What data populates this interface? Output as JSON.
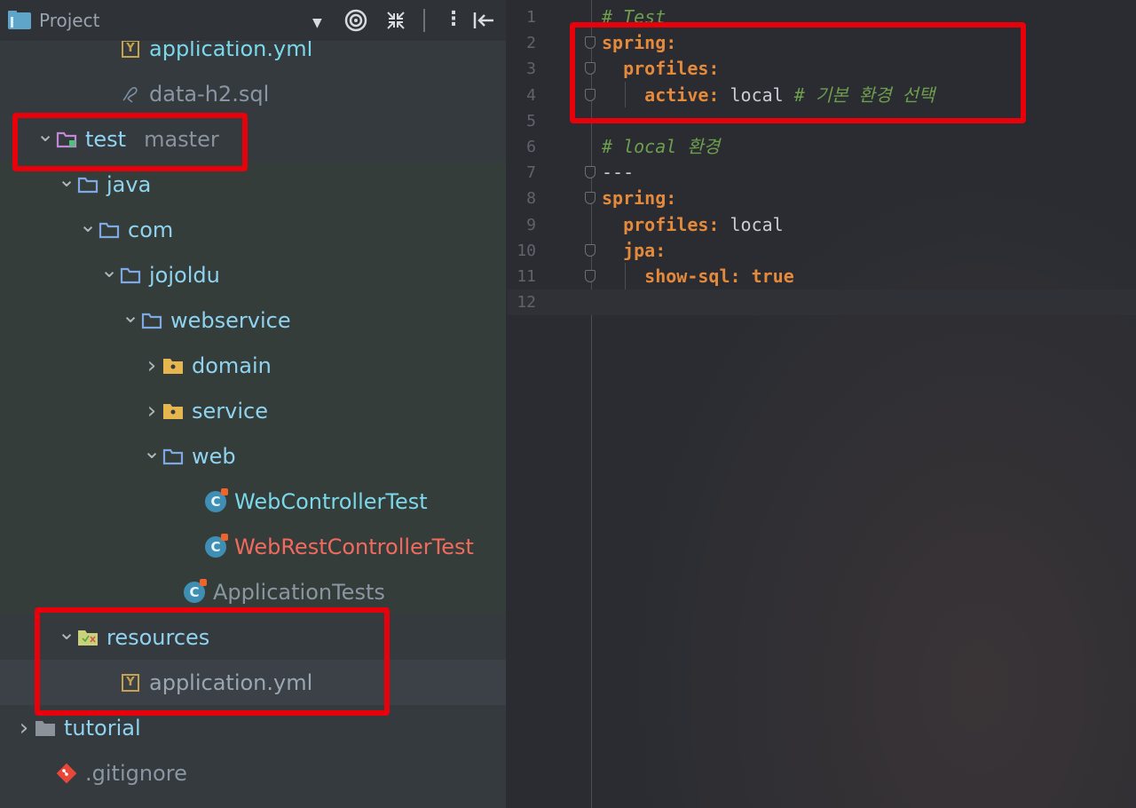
{
  "project_panel": {
    "title": "Project",
    "toolbar_icons": [
      "target-icon",
      "collapse-icon",
      "more-icon",
      "hide-panel-icon"
    ],
    "tree": [
      {
        "label": "application.yml",
        "icon": "yaml-file-icon",
        "indent": 5,
        "color": "teal"
      },
      {
        "label": "data-h2.sql",
        "icon": "sql-file-icon",
        "indent": 5,
        "color": "muted"
      },
      {
        "label": "test",
        "branch": "master",
        "icon": "test-folder-icon",
        "indent": 2,
        "expanded": true
      },
      {
        "label": "java",
        "icon": "folder-icon",
        "indent": 3,
        "expanded": true
      },
      {
        "label": "com",
        "icon": "folder-icon",
        "indent": 4,
        "expanded": true
      },
      {
        "label": "jojoldu",
        "icon": "folder-icon",
        "indent": 5,
        "expanded": true
      },
      {
        "label": "webservice",
        "icon": "folder-icon",
        "indent": 6,
        "expanded": true
      },
      {
        "label": "domain",
        "icon": "package-folder-icon",
        "indent": 7,
        "expanded": false
      },
      {
        "label": "service",
        "icon": "package-folder-icon",
        "indent": 7,
        "expanded": false
      },
      {
        "label": "web",
        "icon": "folder-icon",
        "indent": 7,
        "expanded": true
      },
      {
        "label": "WebControllerTest",
        "icon": "class-icon",
        "indent": 9,
        "color": "teal"
      },
      {
        "label": "WebRestControllerTest",
        "icon": "class-icon",
        "indent": 9,
        "color": "red"
      },
      {
        "label": "ApplicationTests",
        "icon": "class-icon",
        "indent": 8,
        "color": "muted"
      },
      {
        "label": "resources",
        "icon": "resources-folder-icon",
        "indent": 3,
        "expanded": true
      },
      {
        "label": "application.yml",
        "icon": "yaml-file-icon",
        "indent": 5,
        "color": "ygray",
        "selected": true
      },
      {
        "label": "tutorial",
        "icon": "gray-folder-icon",
        "indent": 1,
        "expanded": false
      },
      {
        "label": ".gitignore",
        "icon": "git-icon",
        "indent": 2,
        "color": "muted"
      }
    ]
  },
  "editor": {
    "lines": [
      {
        "n": "1",
        "tokens": [
          {
            "t": "# Test",
            "c": "cm"
          }
        ]
      },
      {
        "n": "2",
        "fold": true,
        "tokens": [
          {
            "t": "spring:",
            "c": "k"
          }
        ]
      },
      {
        "n": "3",
        "fold": true,
        "tokens": [
          {
            "t": "  profiles:",
            "c": "k"
          }
        ]
      },
      {
        "n": "4",
        "fold": true,
        "tokens": [
          {
            "t": "    active:",
            "c": "k"
          },
          {
            "t": " local ",
            "c": "v"
          },
          {
            "t": "# 기본 환경 선택",
            "c": "cm"
          }
        ]
      },
      {
        "n": "5",
        "tokens": []
      },
      {
        "n": "6",
        "tokens": [
          {
            "t": "# local 환경",
            "c": "cm"
          }
        ]
      },
      {
        "n": "7",
        "fold": true,
        "tokens": [
          {
            "t": "---",
            "c": "v"
          }
        ]
      },
      {
        "n": "8",
        "fold": true,
        "tokens": [
          {
            "t": "spring:",
            "c": "k"
          }
        ]
      },
      {
        "n": "9",
        "tokens": [
          {
            "t": "  profiles:",
            "c": "k"
          },
          {
            "t": " local",
            "c": "v"
          }
        ]
      },
      {
        "n": "10",
        "fold": true,
        "tokens": [
          {
            "t": "  jpa:",
            "c": "k"
          }
        ]
      },
      {
        "n": "11",
        "fold": true,
        "tokens": [
          {
            "t": "    show-sql:",
            "c": "k"
          },
          {
            "t": " true",
            "c": "tv"
          }
        ]
      },
      {
        "n": "12",
        "tokens": [],
        "current": true
      }
    ]
  },
  "colors": {
    "highlight_box": "#e8000a",
    "yaml_key": "#e58a3b",
    "comment": "#6d9f4d"
  }
}
